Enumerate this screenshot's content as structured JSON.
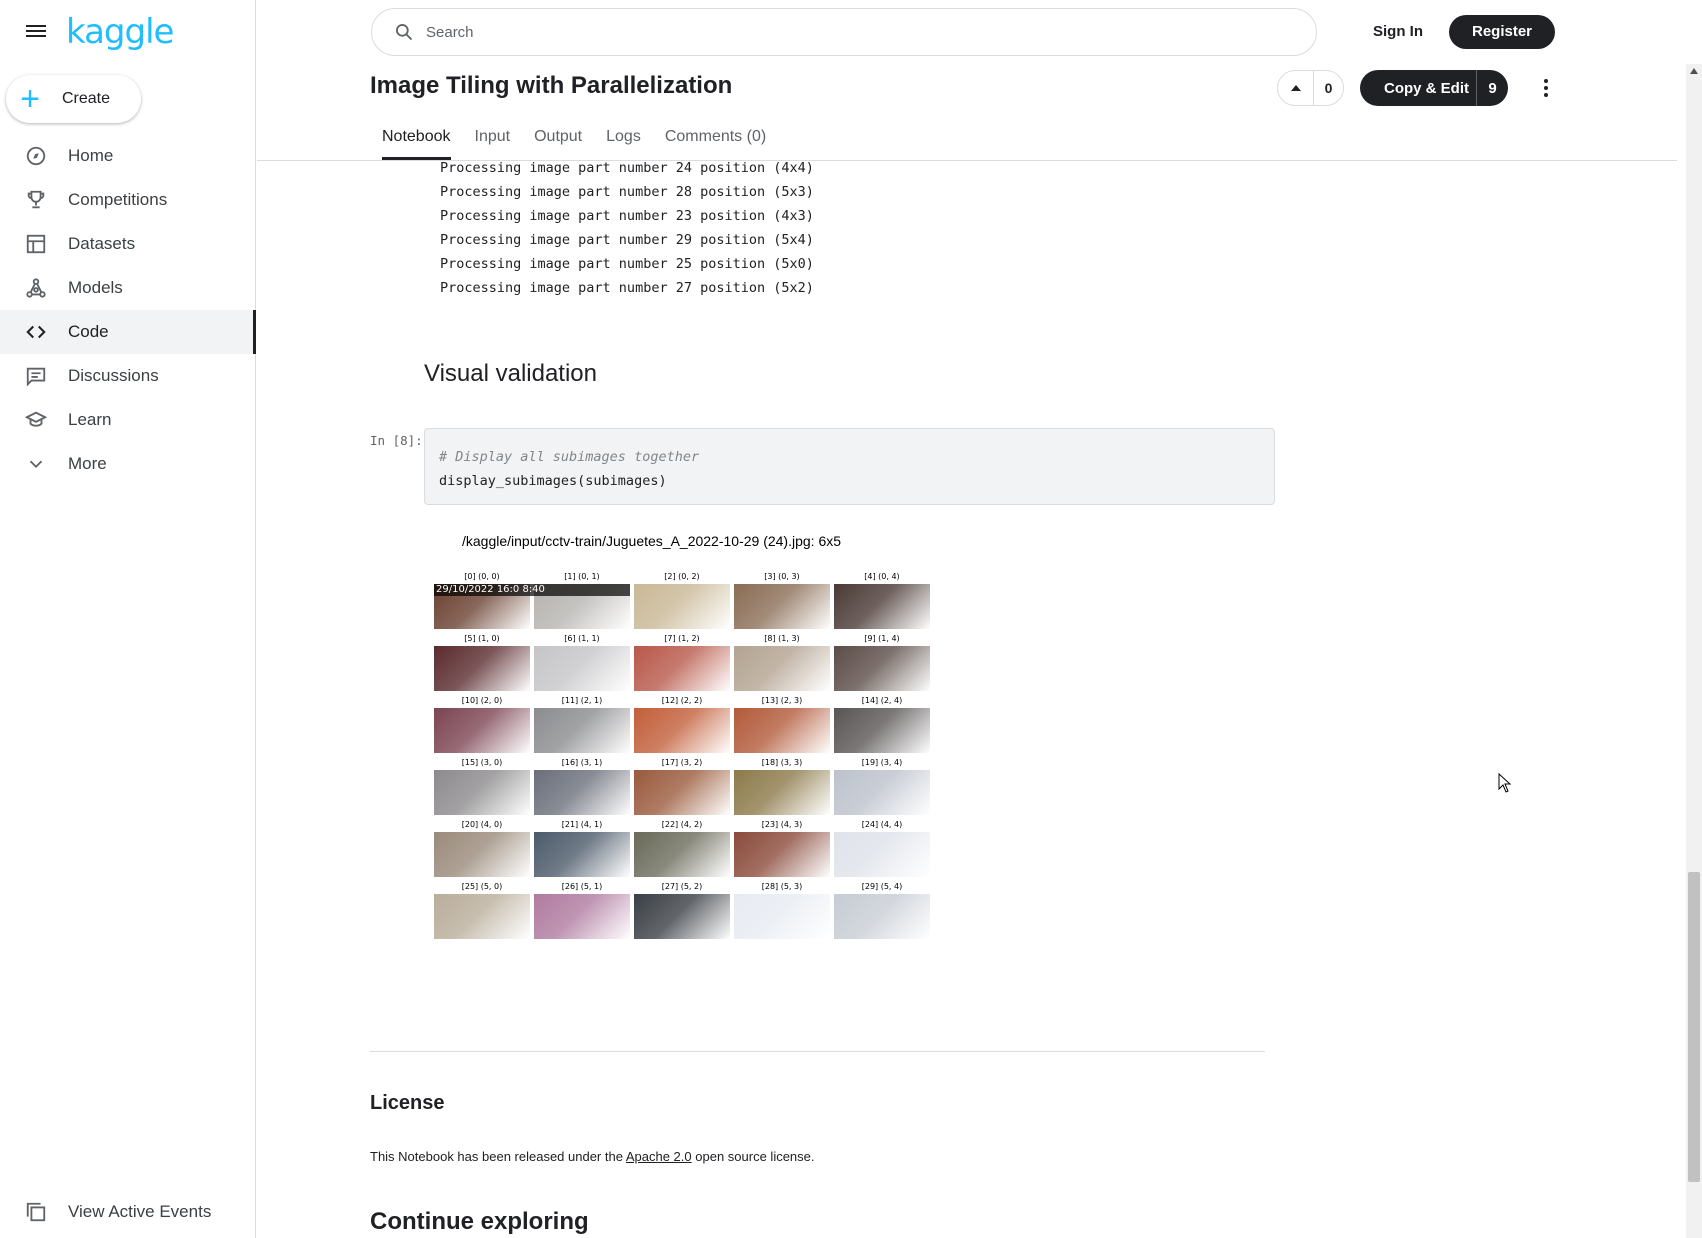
{
  "sidebar": {
    "logo": "kaggle",
    "create_label": "Create",
    "items": [
      {
        "label": "Home",
        "icon": "compass-icon"
      },
      {
        "label": "Competitions",
        "icon": "trophy-icon"
      },
      {
        "label": "Datasets",
        "icon": "table-icon"
      },
      {
        "label": "Models",
        "icon": "models-icon"
      },
      {
        "label": "Code",
        "icon": "code-icon",
        "active": true
      },
      {
        "label": "Discussions",
        "icon": "discussion-icon"
      },
      {
        "label": "Learn",
        "icon": "school-icon"
      },
      {
        "label": "More",
        "icon": "chevron-down-icon"
      }
    ],
    "view_events_label": "View Active Events"
  },
  "header": {
    "search_placeholder": "Search",
    "sign_in_label": "Sign In",
    "register_label": "Register"
  },
  "notebook": {
    "title": "Image Tiling with Parallelization",
    "vote_count": "0",
    "copy_edit_label": "Copy & Edit",
    "copy_edit_count": "9",
    "tabs": [
      "Notebook",
      "Input",
      "Output",
      "Logs",
      "Comments (0)"
    ],
    "active_tab": "Notebook"
  },
  "output_lines": [
    "Processing image part number 24 position (4x4)",
    "Processing image part number 28 position (5x3)",
    "Processing image part number 23 position (4x3)",
    "Processing image part number 29 position (5x4)",
    "Processing image part number 25 position (5x0)",
    "Processing image part number 27 position (5x2)"
  ],
  "section_heading": "Visual validation",
  "code_cell": {
    "prompt": "In [8]:",
    "comment": "# Display all subimages together",
    "code": "display_subimages(subimages)"
  },
  "figure": {
    "title": "/kaggle/input/cctv-train/Juguetes_A_2022-10-29 (24).jpg: 6x5",
    "timestamp_overlay": "29/10/2022 16:0 8:40",
    "tile_labels": [
      "[0] (0, 0)",
      "[1] (0, 1)",
      "[2] (0, 2)",
      "[3] (0, 3)",
      "[4] (0, 4)",
      "[5] (1, 0)",
      "[6] (1, 1)",
      "[7] (1, 2)",
      "[8] (1, 3)",
      "[9] (1, 4)",
      "[10] (2, 0)",
      "[11] (2, 1)",
      "[12] (2, 2)",
      "[13] (2, 3)",
      "[14] (2, 4)",
      "[15] (3, 0)",
      "[16] (3, 1)",
      "[17] (3, 2)",
      "[18] (3, 3)",
      "[19] (3, 4)",
      "[20] (4, 0)",
      "[21] (4, 1)",
      "[22] (4, 2)",
      "[23] (4, 3)",
      "[24] (4, 4)",
      "[25] (5, 0)",
      "[26] (5, 1)",
      "[27] (5, 2)",
      "[28] (5, 3)",
      "[29] (5, 4)"
    ],
    "tile_colors": [
      [
        "#6a4030",
        "#b6b3b0",
        "#c9b896",
        "#8a6d55",
        "#4a3a35"
      ],
      [
        "#5a2b2e",
        "#c5c5c8",
        "#b8584a",
        "#b3a391",
        "#5c4d48"
      ],
      [
        "#7c4453",
        "#8b8c8f",
        "#c25e3a",
        "#b25a3a",
        "#5a5555"
      ],
      [
        "#8c8a8c",
        "#6a6f7a",
        "#9a5a3c",
        "#8c7a4a",
        "#bcc2cc"
      ],
      [
        "#9a8a7a",
        "#4c5a6a",
        "#6a6a5a",
        "#8a4a3a",
        "#dfe3ea"
      ],
      [
        "#b9ad9a",
        "#b07aa0",
        "#3a3f45",
        "#e7ebf2",
        "#c7ccd4"
      ]
    ]
  },
  "license": {
    "title": "License",
    "text_before": "This Notebook has been released under the",
    "link": "Apache 2.0",
    "text_after": "open source license."
  },
  "continue_title": "Continue exploring"
}
